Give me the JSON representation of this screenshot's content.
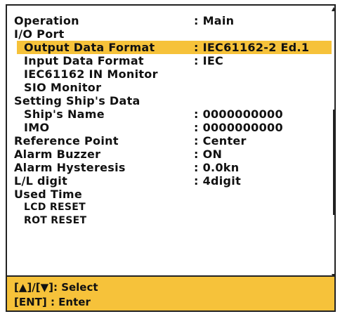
{
  "menu": {
    "items": [
      {
        "label": "Operation",
        "value": ": Main"
      },
      {
        "label": "I/O Port",
        "value": ""
      },
      {
        "label": "Output Data Format",
        "value": ": IEC61162-2 Ed.1"
      },
      {
        "label": "Input Data Format",
        "value": ": IEC"
      },
      {
        "label": "IEC61162 IN Monitor",
        "value": ""
      },
      {
        "label": "SIO Monitor",
        "value": ""
      },
      {
        "label": "Setting Ship's Data",
        "value": ""
      },
      {
        "label": "Ship's Name",
        "value": ": 0000000000"
      },
      {
        "label": "IMO",
        "value": ": 0000000000"
      },
      {
        "label": "Reference Point",
        "value": ": Center"
      },
      {
        "label": "Alarm Buzzer",
        "value": ": ON"
      },
      {
        "label": "Alarm Hysteresis",
        "value": ": 0.0kn"
      },
      {
        "label": "L/L digit",
        "value": ": 4digit"
      },
      {
        "label": "Used Time",
        "value": ""
      },
      {
        "label": "LCD RESET",
        "value": ""
      },
      {
        "label": "ROT RESET",
        "value": ""
      }
    ],
    "selected_index": 2
  },
  "footer": {
    "select_hint": "[▲]/[▼]: Select",
    "enter_hint": "[ENT] : Enter"
  },
  "colors": {
    "highlight": "#f6c23a",
    "border": "#222222"
  }
}
